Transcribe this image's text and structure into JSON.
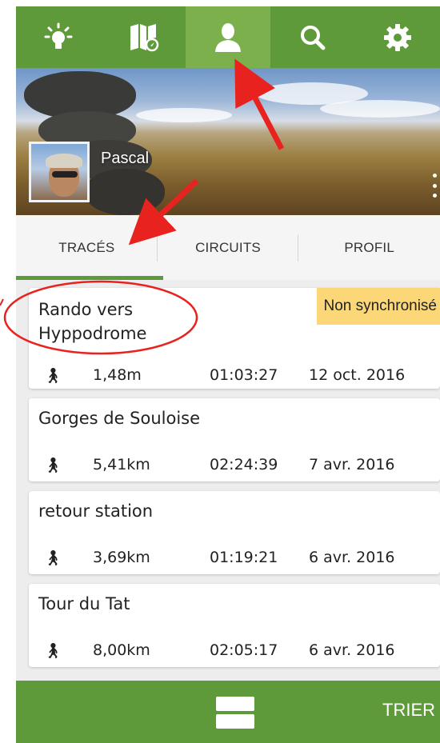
{
  "nav": {
    "items": [
      {
        "icon": "lightbulb-icon"
      },
      {
        "icon": "map-icon"
      },
      {
        "icon": "profile-icon",
        "active": true
      },
      {
        "icon": "search-icon"
      },
      {
        "icon": "settings-gear-icon"
      }
    ]
  },
  "profile": {
    "name": "Pascal"
  },
  "tabs": [
    {
      "label": "TRACÉS",
      "active": true
    },
    {
      "label": "CIRCUITS"
    },
    {
      "label": "PROFIL"
    }
  ],
  "tracks": [
    {
      "title": "Rando vers Hyppodrome",
      "badge": "Non synchronisé",
      "distance": "1,48m",
      "duration": "01:03:27",
      "date": "12 oct. 2016"
    },
    {
      "title": "Gorges de Souloise",
      "distance": "5,41km",
      "duration": "02:24:39",
      "date": "7 avr. 2016"
    },
    {
      "title": "retour station",
      "distance": "3,69km",
      "duration": "01:19:21",
      "date": "6 avr. 2016"
    },
    {
      "title": "Tour du Tat",
      "distance": "8,00km",
      "duration": "02:05:17",
      "date": "6 avr. 2016"
    }
  ],
  "bottom": {
    "sort_label": "TRIER"
  },
  "colors": {
    "primary": "#5f9a3a",
    "primary_active": "#7cb04c",
    "badge": "#fbd777",
    "annotation": "#e8231f"
  }
}
